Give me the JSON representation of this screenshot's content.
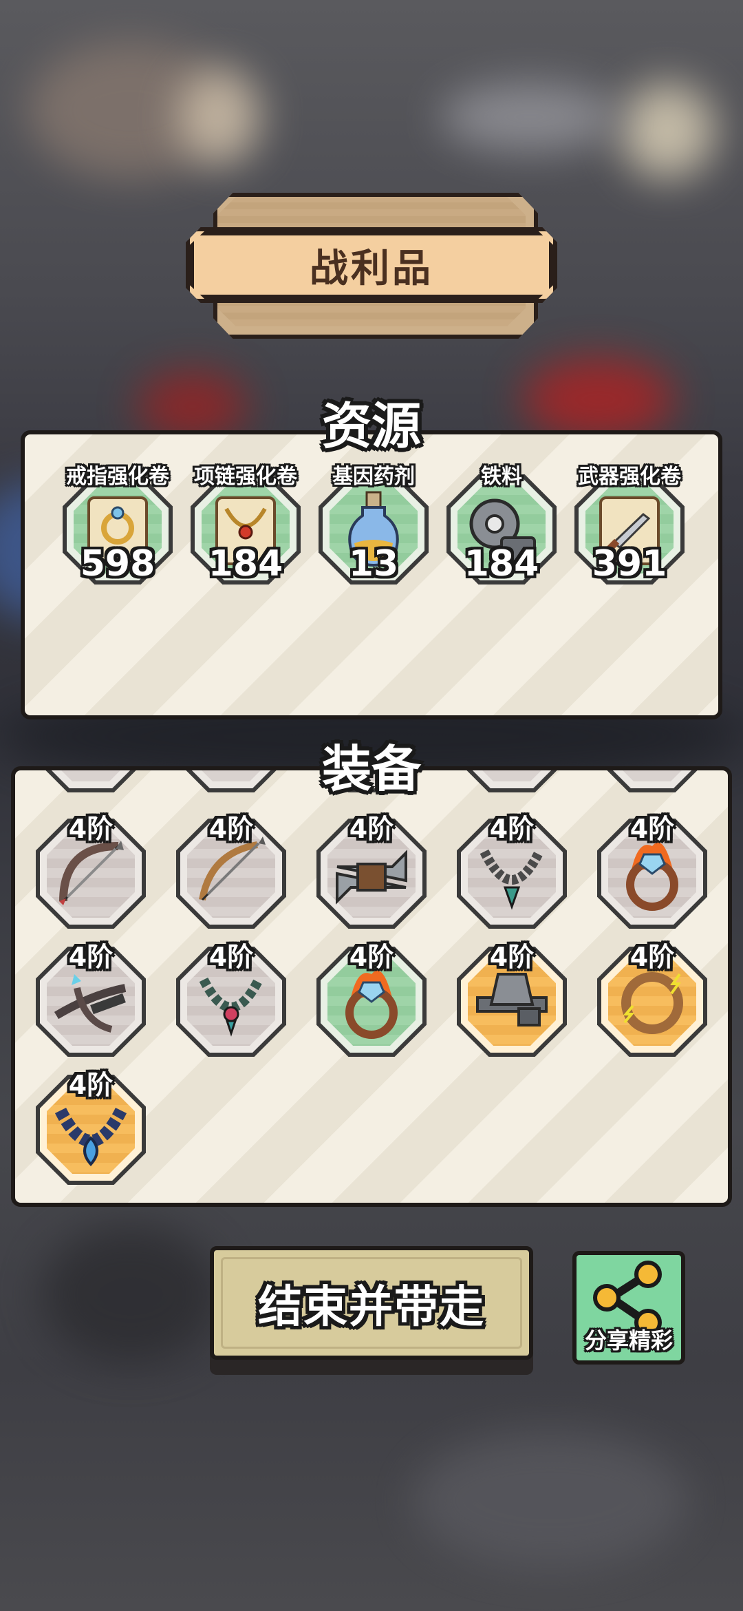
{
  "title": "战利品",
  "resources": {
    "heading": "资源",
    "items": [
      {
        "label": "戒指强化卷",
        "count": "598",
        "icon": "ring-scroll-icon"
      },
      {
        "label": "项链强化卷",
        "count": "184",
        "icon": "necklace-scroll-icon"
      },
      {
        "label": "基因药剂",
        "count": "13",
        "icon": "gene-potion-icon"
      },
      {
        "label": "铁料",
        "count": "184",
        "icon": "iron-material-icon"
      },
      {
        "label": "武器强化卷",
        "count": "391",
        "icon": "weapon-scroll-icon"
      }
    ]
  },
  "equipment": {
    "heading": "装备",
    "items": [
      {
        "tier": "4阶",
        "icon": "bow-icon",
        "rarity": "grey"
      },
      {
        "tier": "4阶",
        "icon": "recurve-bow-icon",
        "rarity": "grey"
      },
      {
        "tier": "4阶",
        "icon": "boomerang-blades-icon",
        "rarity": "grey"
      },
      {
        "tier": "4阶",
        "icon": "necklace-icon",
        "rarity": "grey"
      },
      {
        "tier": "4阶",
        "icon": "fire-ring-icon",
        "rarity": "grey"
      },
      {
        "tier": "4阶",
        "icon": "crossbow-icon",
        "rarity": "grey"
      },
      {
        "tier": "4阶",
        "icon": "jeweled-necklace-icon",
        "rarity": "grey"
      },
      {
        "tier": "4阶",
        "icon": "fire-ring-icon",
        "rarity": "green"
      },
      {
        "tier": "4阶",
        "icon": "heavy-crossbow-icon",
        "rarity": "gold"
      },
      {
        "tier": "4阶",
        "icon": "lightning-ring-icon",
        "rarity": "gold"
      },
      {
        "tier": "4阶",
        "icon": "sapphire-necklace-icon",
        "rarity": "gold"
      }
    ]
  },
  "buttons": {
    "finish": "结束并带走",
    "share": "分享精彩"
  }
}
